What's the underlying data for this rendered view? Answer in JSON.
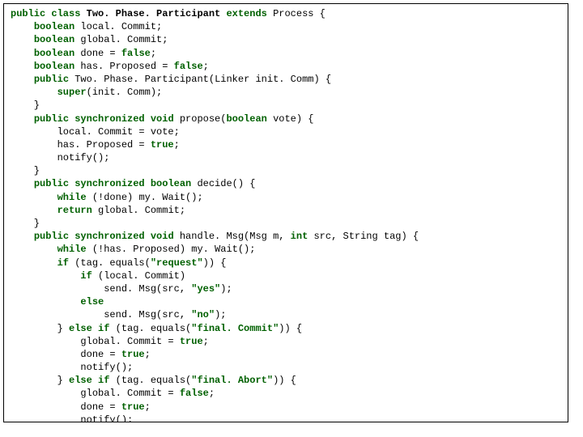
{
  "code": {
    "lines": [
      [
        {
          "t": "public class ",
          "c": "kw"
        },
        {
          "t": "Two. Phase. Participant ",
          "c": "bold"
        },
        {
          "t": "extends ",
          "c": "kw"
        },
        {
          "t": "Process {",
          "c": ""
        }
      ],
      [
        {
          "t": "    ",
          "c": ""
        },
        {
          "t": "boolean ",
          "c": "kw"
        },
        {
          "t": "local. Commit;",
          "c": ""
        }
      ],
      [
        {
          "t": "    ",
          "c": ""
        },
        {
          "t": "boolean ",
          "c": "kw"
        },
        {
          "t": "global. Commit;",
          "c": ""
        }
      ],
      [
        {
          "t": "    ",
          "c": ""
        },
        {
          "t": "boolean ",
          "c": "kw"
        },
        {
          "t": "done = ",
          "c": ""
        },
        {
          "t": "false",
          "c": "kw"
        },
        {
          "t": ";",
          "c": ""
        }
      ],
      [
        {
          "t": "    ",
          "c": ""
        },
        {
          "t": "boolean ",
          "c": "kw"
        },
        {
          "t": "has. Proposed = ",
          "c": ""
        },
        {
          "t": "false",
          "c": "kw"
        },
        {
          "t": ";",
          "c": ""
        }
      ],
      [
        {
          "t": "    ",
          "c": ""
        },
        {
          "t": "public ",
          "c": "kw"
        },
        {
          "t": "Two. Phase. Participant(Linker init. Comm) {",
          "c": ""
        }
      ],
      [
        {
          "t": "        ",
          "c": ""
        },
        {
          "t": "super",
          "c": "kw"
        },
        {
          "t": "(init. Comm);",
          "c": ""
        }
      ],
      [
        {
          "t": "    }",
          "c": ""
        }
      ],
      [
        {
          "t": "    ",
          "c": ""
        },
        {
          "t": "public synchronized void ",
          "c": "kw"
        },
        {
          "t": "propose(",
          "c": ""
        },
        {
          "t": "boolean ",
          "c": "kw"
        },
        {
          "t": "vote) {",
          "c": ""
        }
      ],
      [
        {
          "t": "        local. Commit = vote;",
          "c": ""
        }
      ],
      [
        {
          "t": "        has. Proposed = ",
          "c": ""
        },
        {
          "t": "true",
          "c": "kw"
        },
        {
          "t": ";",
          "c": ""
        }
      ],
      [
        {
          "t": "        notify();",
          "c": ""
        }
      ],
      [
        {
          "t": "    }",
          "c": ""
        }
      ],
      [
        {
          "t": "    ",
          "c": ""
        },
        {
          "t": "public synchronized boolean ",
          "c": "kw"
        },
        {
          "t": "decide() {",
          "c": ""
        }
      ],
      [
        {
          "t": "        ",
          "c": ""
        },
        {
          "t": "while ",
          "c": "kw"
        },
        {
          "t": "(!done) my. Wait();",
          "c": ""
        }
      ],
      [
        {
          "t": "        ",
          "c": ""
        },
        {
          "t": "return ",
          "c": "kw"
        },
        {
          "t": "global. Commit;",
          "c": ""
        }
      ],
      [
        {
          "t": "    }",
          "c": ""
        }
      ],
      [
        {
          "t": "    ",
          "c": ""
        },
        {
          "t": "public synchronized void ",
          "c": "kw"
        },
        {
          "t": "handle. Msg(Msg m, ",
          "c": ""
        },
        {
          "t": "int ",
          "c": "kw"
        },
        {
          "t": "src, String tag) {",
          "c": ""
        }
      ],
      [
        {
          "t": "        ",
          "c": ""
        },
        {
          "t": "while ",
          "c": "kw"
        },
        {
          "t": "(!has. Proposed) my. Wait();",
          "c": ""
        }
      ],
      [
        {
          "t": "        ",
          "c": ""
        },
        {
          "t": "if ",
          "c": "kw"
        },
        {
          "t": "(tag. equals(",
          "c": ""
        },
        {
          "t": "\"request\"",
          "c": "str"
        },
        {
          "t": ")) {",
          "c": ""
        }
      ],
      [
        {
          "t": "            ",
          "c": ""
        },
        {
          "t": "if ",
          "c": "kw"
        },
        {
          "t": "(local. Commit)",
          "c": ""
        }
      ],
      [
        {
          "t": "                send. Msg(src, ",
          "c": ""
        },
        {
          "t": "\"yes\"",
          "c": "str"
        },
        {
          "t": ");",
          "c": ""
        }
      ],
      [
        {
          "t": "            ",
          "c": ""
        },
        {
          "t": "else",
          "c": "kw"
        }
      ],
      [
        {
          "t": "                send. Msg(src, ",
          "c": ""
        },
        {
          "t": "\"no\"",
          "c": "str"
        },
        {
          "t": ");",
          "c": ""
        }
      ],
      [
        {
          "t": "        } ",
          "c": ""
        },
        {
          "t": "else if ",
          "c": "kw"
        },
        {
          "t": "(tag. equals(",
          "c": ""
        },
        {
          "t": "\"final. Commit\"",
          "c": "str"
        },
        {
          "t": ")) {",
          "c": ""
        }
      ],
      [
        {
          "t": "            global. Commit = ",
          "c": ""
        },
        {
          "t": "true",
          "c": "kw"
        },
        {
          "t": ";",
          "c": ""
        }
      ],
      [
        {
          "t": "            done = ",
          "c": ""
        },
        {
          "t": "true",
          "c": "kw"
        },
        {
          "t": ";",
          "c": ""
        }
      ],
      [
        {
          "t": "            notify();",
          "c": ""
        }
      ],
      [
        {
          "t": "        } ",
          "c": ""
        },
        {
          "t": "else if ",
          "c": "kw"
        },
        {
          "t": "(tag. equals(",
          "c": ""
        },
        {
          "t": "\"final. Abort\"",
          "c": "str"
        },
        {
          "t": ")) {",
          "c": ""
        }
      ],
      [
        {
          "t": "            global. Commit = ",
          "c": ""
        },
        {
          "t": "false",
          "c": "kw"
        },
        {
          "t": ";",
          "c": ""
        }
      ],
      [
        {
          "t": "            done = ",
          "c": ""
        },
        {
          "t": "true",
          "c": "kw"
        },
        {
          "t": ";",
          "c": ""
        }
      ],
      [
        {
          "t": "            notify();",
          "c": ""
        }
      ],
      [
        {
          "t": "}   }   }",
          "c": ""
        }
      ]
    ]
  }
}
